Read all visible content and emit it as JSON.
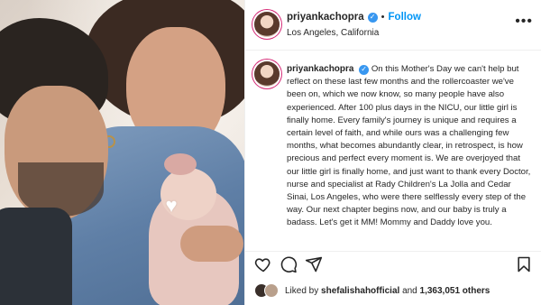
{
  "post": {
    "username": "priyankachopra",
    "follow_label": "Follow",
    "separator": "•",
    "location": "Los Angeles, California",
    "caption": "On this Mother's Day we can't help but reflect on these last few months and the rollercoaster we've been on, which we now know, so many people have also experienced. After 100 plus days in the NICU, our little girl is finally home. Every family's journey is unique and requires a certain level of faith, and while ours was a challenging few months, what becomes abundantly clear, in retrospect, is how precious and perfect every moment is. We are overjoyed that our little girl is finally home, and just want to thank every Doctor, nurse and specialist at Rady Children's La Jolla and Cedar Sinai, Los Angeles, who were there selflessly every step of the way. Our next chapter begins now, and our baby is truly a badass. Let's get it MM! Mommy and Daddy love you.",
    "liked_by_prefix": "Liked by",
    "liked_by_user": "shefalishahofficial",
    "liked_by_and": "and",
    "likes_count": "1,363,051 others"
  },
  "icons": {
    "more": "more-options-icon",
    "like": "heart-icon",
    "comment": "comment-icon",
    "share": "share-icon",
    "save": "bookmark-icon",
    "verified": "verified-badge-icon",
    "photo_heart": "heart-icon"
  },
  "colors": {
    "accent": "#0095f6",
    "verified": "#3897f0",
    "text": "#262626",
    "border": "#efefef"
  }
}
